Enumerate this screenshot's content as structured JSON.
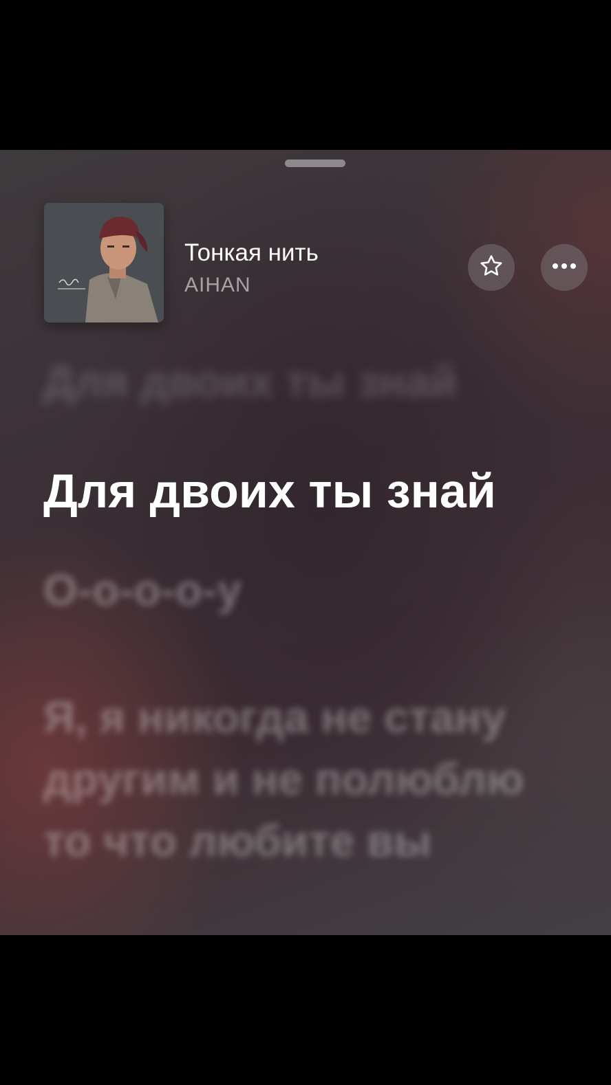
{
  "now_playing": {
    "title": "Тонкая нить",
    "artist": "AIHAN",
    "artwork_icon": "album-artwork",
    "favorite_icon": "star-icon",
    "more_icon": "ellipsis-icon"
  },
  "lyrics": [
    {
      "text": "Для двоих ты знай",
      "state": "previous"
    },
    {
      "text": "Для двоих ты знай",
      "state": "active"
    },
    {
      "text": "О-о-о-о-у",
      "state": "upcoming"
    },
    {
      "text": "Я, я никогда не стану другим и не полюблю то что любите вы",
      "state": "upcoming"
    }
  ],
  "colors": {
    "active_lyric": "#ffffff",
    "inactive_lyric": "#ffffff52",
    "button_bg": "#78707480"
  }
}
